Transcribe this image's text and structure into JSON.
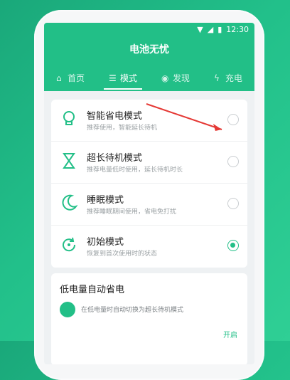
{
  "status": {
    "time": "12:30"
  },
  "app": {
    "title": "电池无忧",
    "tabs": [
      {
        "label": "首页"
      },
      {
        "label": "模式"
      },
      {
        "label": "发现"
      },
      {
        "label": "充电"
      }
    ],
    "selected_tab": "模式"
  },
  "modes": [
    {
      "name": "智能省电模式",
      "desc": "推荐使用，智能延长待机",
      "selected": false
    },
    {
      "name": "超长待机模式",
      "desc": "推荐电量低时使用，延长待机时长",
      "selected": false
    },
    {
      "name": "睡眠模式",
      "desc": "推荐睡眠期间使用，省电免打扰",
      "selected": false
    },
    {
      "name": "初始模式",
      "desc": "恢复到首次使用时的状态",
      "selected": true
    }
  ],
  "low_battery": {
    "title": "低电量自动省电",
    "desc": "在低电量时自动切换为超长待机模式",
    "toggle_label": "开启"
  },
  "colors": {
    "accent": "#22bf87",
    "annotation": "#e53935"
  }
}
